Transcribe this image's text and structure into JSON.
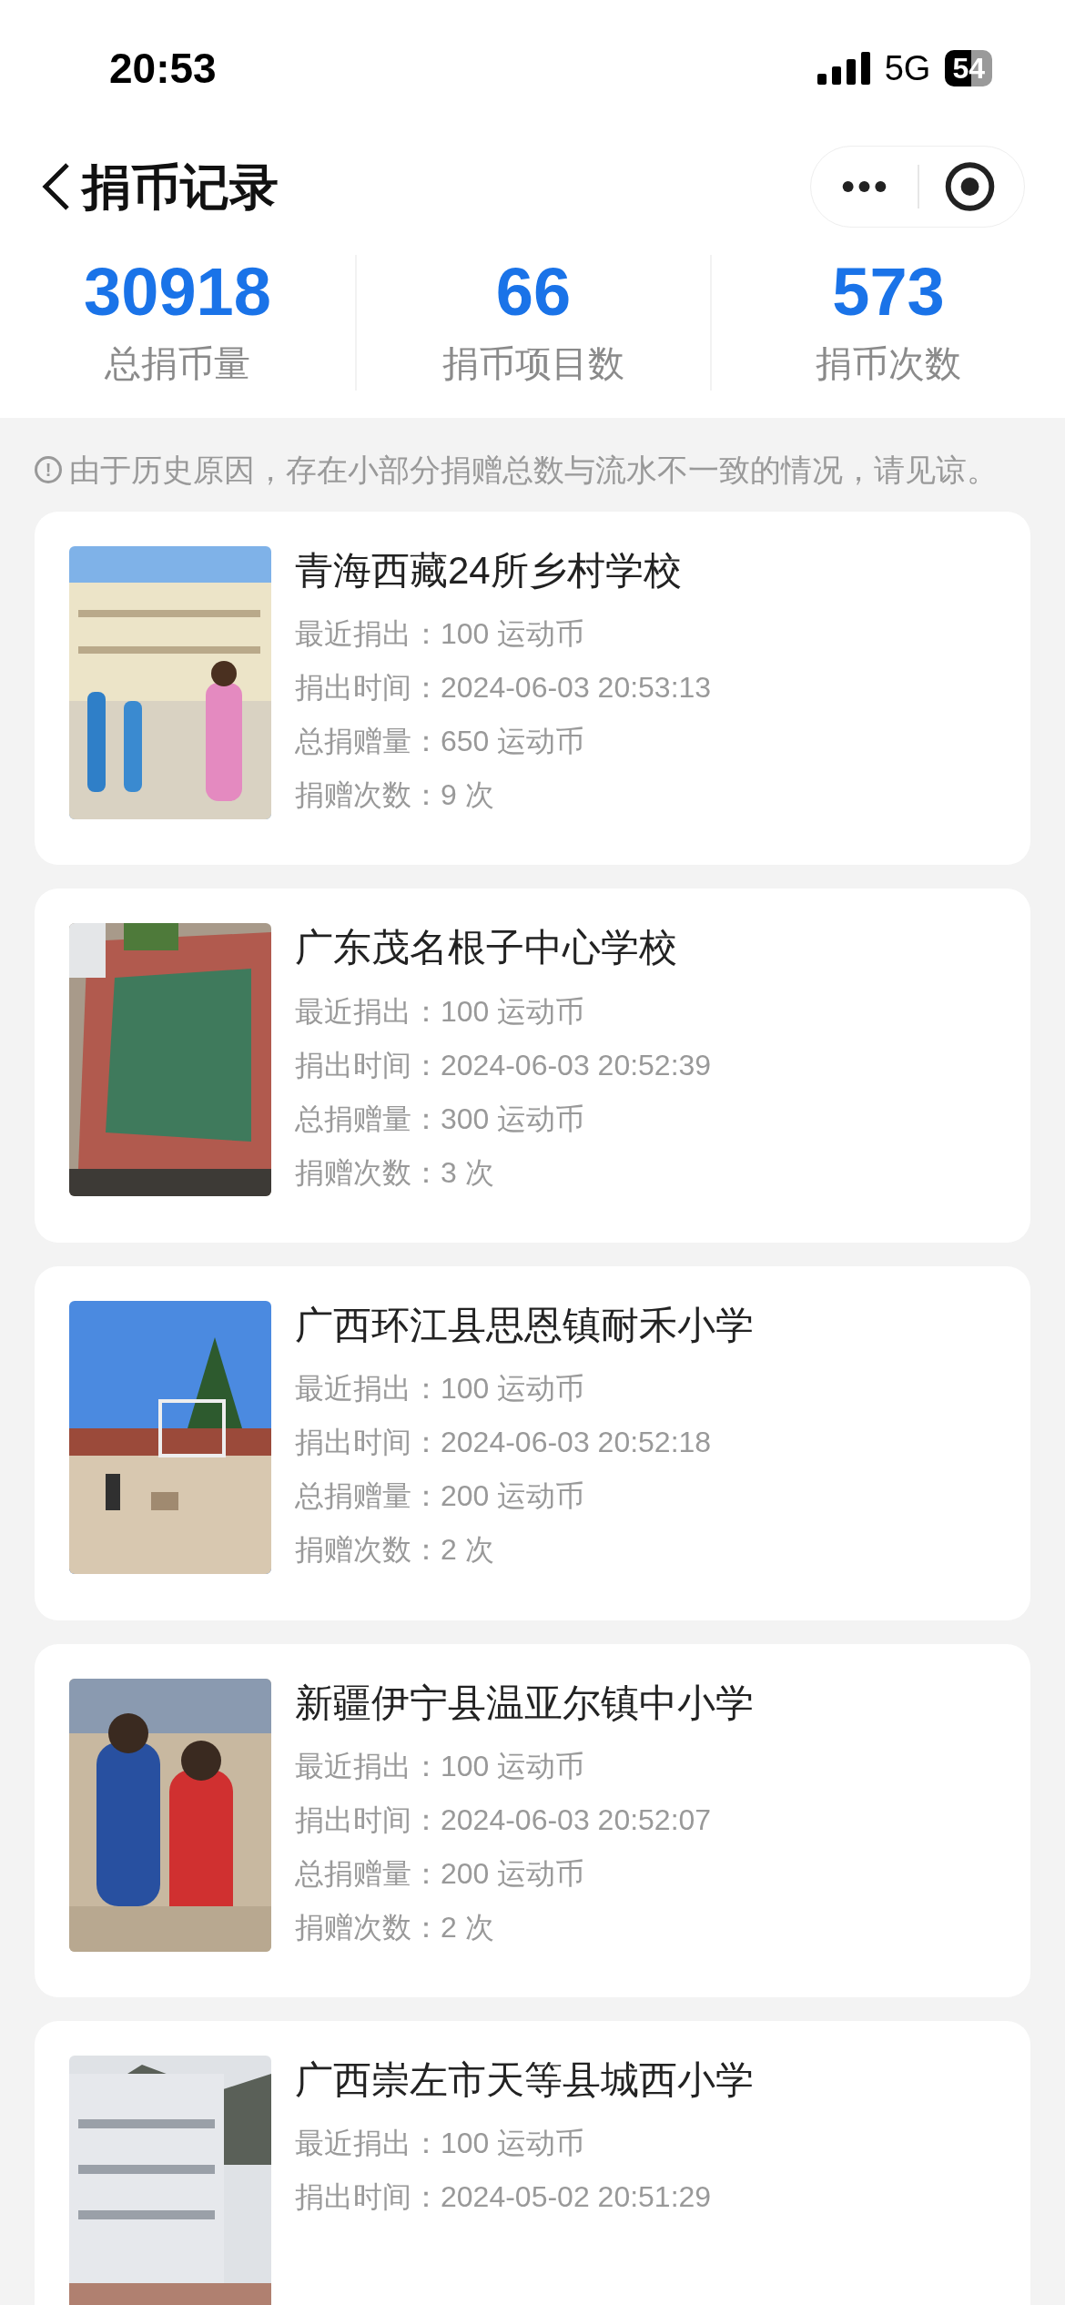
{
  "status_bar": {
    "time": "20:53",
    "network": "5G",
    "battery": "54"
  },
  "header": {
    "title": "捐币记录"
  },
  "stats": [
    {
      "value": "30918",
      "label": "总捐币量"
    },
    {
      "value": "66",
      "label": "捐币项目数"
    },
    {
      "value": "573",
      "label": "捐币次数"
    }
  ],
  "notice": {
    "icon": "!",
    "text": "由于历史原因，存在小部分捐赠总数与流水不一致的情况，请见谅。"
  },
  "records": [
    {
      "name": "青海西藏24所乡村学校",
      "fields": [
        {
          "label": "最近捐出：",
          "value": "100 运动币"
        },
        {
          "label": "捐出时间：",
          "value": "2024-06-03 20:53:13"
        },
        {
          "label": "总捐赠量：",
          "value": "650 运动币"
        },
        {
          "label": "捐赠次数：",
          "value": "9 次"
        }
      ]
    },
    {
      "name": "广东茂名根子中心学校",
      "fields": [
        {
          "label": "最近捐出：",
          "value": "100 运动币"
        },
        {
          "label": "捐出时间：",
          "value": "2024-06-03 20:52:39"
        },
        {
          "label": "总捐赠量：",
          "value": "300 运动币"
        },
        {
          "label": "捐赠次数：",
          "value": "3 次"
        }
      ]
    },
    {
      "name": "广西环江县思恩镇耐禾小学",
      "fields": [
        {
          "label": "最近捐出：",
          "value": "100 运动币"
        },
        {
          "label": "捐出时间：",
          "value": "2024-06-03 20:52:18"
        },
        {
          "label": "总捐赠量：",
          "value": "200 运动币"
        },
        {
          "label": "捐赠次数：",
          "value": "2 次"
        }
      ]
    },
    {
      "name": "新疆伊宁县温亚尔镇中小学",
      "fields": [
        {
          "label": "最近捐出：",
          "value": "100 运动币"
        },
        {
          "label": "捐出时间：",
          "value": "2024-06-03 20:52:07"
        },
        {
          "label": "总捐赠量：",
          "value": "200 运动币"
        },
        {
          "label": "捐赠次数：",
          "value": "2 次"
        }
      ]
    },
    {
      "name": "广西崇左市天等县城西小学",
      "fields": [
        {
          "label": "最近捐出：",
          "value": "100 运动币"
        },
        {
          "label": "捐出时间：",
          "value": "2024-05-02 20:51:29"
        }
      ]
    }
  ]
}
